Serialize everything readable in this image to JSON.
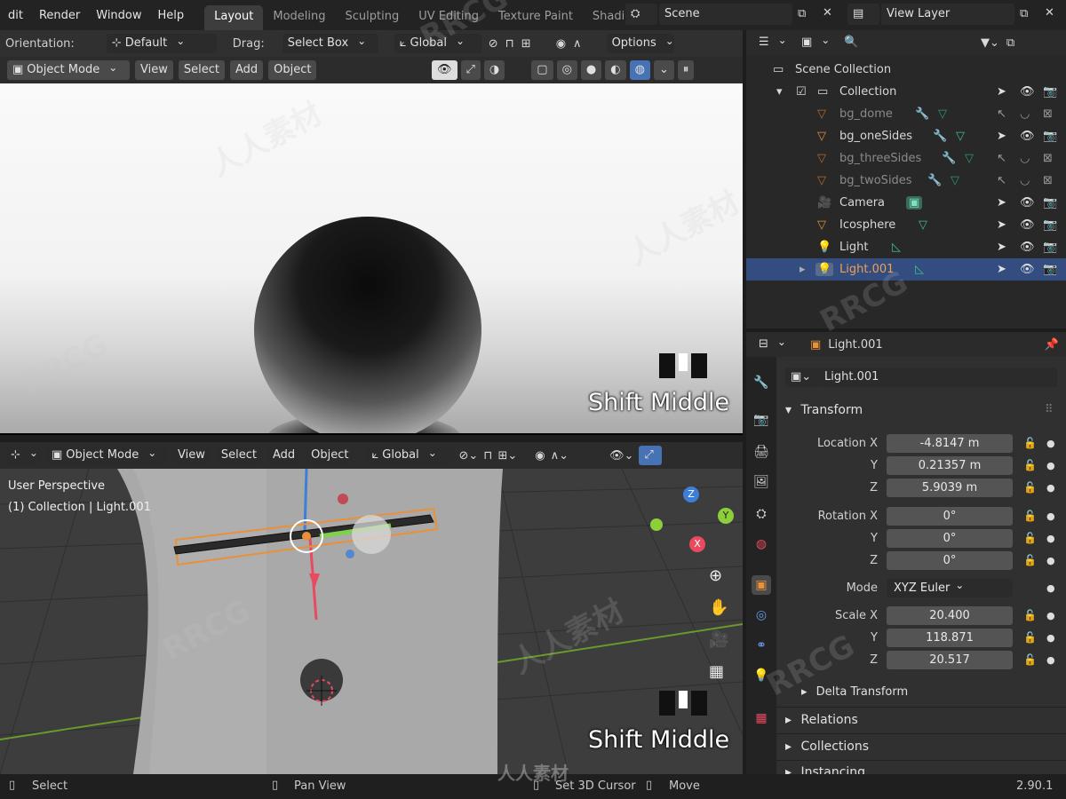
{
  "menu": [
    "dit",
    "Render",
    "Window",
    "Help"
  ],
  "workspace_tabs": [
    {
      "label": "Layout",
      "active": true
    },
    {
      "label": "Modeling"
    },
    {
      "label": "Sculpting"
    },
    {
      "label": "UV Editing"
    },
    {
      "label": "Texture Paint"
    },
    {
      "label": "Shading"
    }
  ],
  "scene": {
    "label": "Scene"
  },
  "view_layer": {
    "label": "View Layer"
  },
  "tool_settings": {
    "orientation_label": "Orientation:",
    "orientation_value": "Default",
    "drag_label": "Drag:",
    "drag_value": "Select Box",
    "transform_value": "Global",
    "options_label": "Options"
  },
  "viewport_top": {
    "mode": "Object Mode",
    "menus": [
      "View",
      "Select",
      "Add",
      "Object"
    ],
    "overlay_text": "Shift Middle"
  },
  "viewport_bottom": {
    "mode": "Object Mode",
    "menus": [
      "View",
      "Select",
      "Add",
      "Object"
    ],
    "transform_value": "Global",
    "info_line1": "User Perspective",
    "info_line2": "(1) Collection | Light.001",
    "overlay_text": "Shift Middle",
    "gizmo_axes": {
      "z": "Z",
      "y": "Y",
      "x": "X"
    }
  },
  "outliner": {
    "root": "Scene Collection",
    "collection": "Collection",
    "items": [
      {
        "name": "bg_dome",
        "dim": true
      },
      {
        "name": "bg_oneSides",
        "dim": false
      },
      {
        "name": "bg_threeSides",
        "dim": true
      },
      {
        "name": "bg_twoSides",
        "dim": true
      },
      {
        "name": "Camera",
        "dim": false
      },
      {
        "name": "Icosphere",
        "dim": false
      },
      {
        "name": "Light",
        "dim": false
      },
      {
        "name": "Light.001",
        "dim": false,
        "selected": true
      }
    ]
  },
  "properties": {
    "header_object": "Light.001",
    "object_name": "Light.001",
    "transform_title": "Transform",
    "location": {
      "label": "Location X",
      "x": "-4.8147 m",
      "y": "0.21357 m",
      "z": "5.9039 m"
    },
    "rotation": {
      "label": "Rotation X",
      "x": "0°",
      "y": "0°",
      "z": "0°"
    },
    "axis_y": "Y",
    "axis_z": "Z",
    "mode_label": "Mode",
    "mode_value": "XYZ Euler",
    "scale": {
      "label": "Scale X",
      "x": "20.400",
      "y": "118.871",
      "z": "20.517"
    },
    "delta_transform": "Delta Transform",
    "relations": "Relations",
    "collections": "Collections",
    "instancing": "Instancing"
  },
  "statusbar": {
    "select": "Select",
    "pan_view": "Pan View",
    "set_cursor": "Set 3D Cursor",
    "move": "Move",
    "version": "2.90.1"
  },
  "watermark": {
    "rrcg": "RRCG",
    "cn": "人人素材"
  },
  "colors": {
    "accent": "#4772b3",
    "selection": "#334d80",
    "object_orange": "#e8903a",
    "light_green": "#3fbf8a"
  }
}
